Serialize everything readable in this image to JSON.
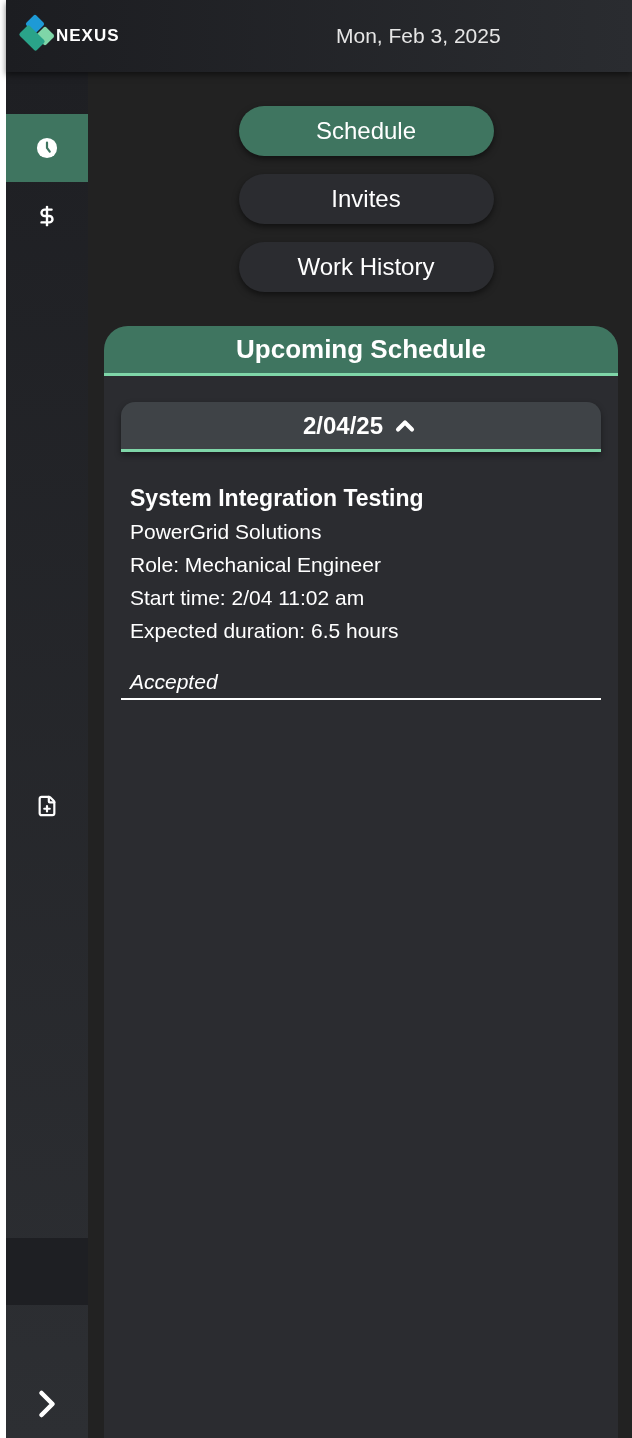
{
  "header": {
    "logo_text": "NEXUS",
    "date": "Mon, Feb 3, 2025"
  },
  "sidebar": {
    "items": [
      {
        "kind": "clock",
        "selected": true
      },
      {
        "kind": "dollar",
        "selected": false
      },
      {
        "kind": "file-add",
        "selected": false
      }
    ]
  },
  "tabs": [
    {
      "label": "Schedule",
      "selected": true
    },
    {
      "label": "Invites",
      "selected": false
    },
    {
      "label": "Work History",
      "selected": false
    }
  ],
  "panel": {
    "title": "Upcoming Schedule",
    "groups": [
      {
        "date": "2/04/25",
        "expanded": true,
        "entries": [
          {
            "title": "System Integration Testing",
            "company": "PowerGrid Solutions",
            "role": "Role: Mechanical Engineer",
            "start": "Start time: 2/04 11:02 am",
            "duration": "Expected duration: 6.5 hours",
            "status": "Accepted"
          }
        ]
      }
    ]
  }
}
